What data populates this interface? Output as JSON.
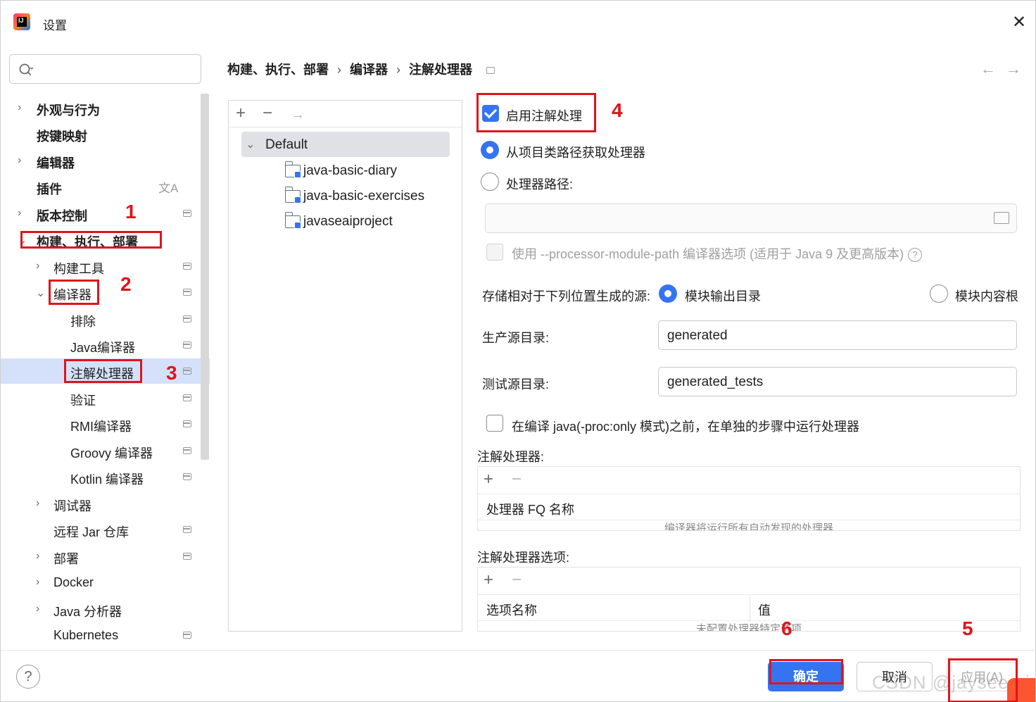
{
  "window": {
    "title": "设置",
    "close_glyph": "✕"
  },
  "search": {
    "placeholder": ""
  },
  "sidebar": {
    "items": [
      {
        "label": "外观与行为",
        "bold": true
      },
      {
        "label": "按键映射",
        "bold": true
      },
      {
        "label": "编辑器",
        "bold": true
      },
      {
        "label": "插件",
        "bold": true
      },
      {
        "label": "版本控制",
        "bold": true
      },
      {
        "label": "构建、执行、部署",
        "bold": true
      },
      {
        "label": "构建工具"
      },
      {
        "label": "编译器"
      },
      {
        "label": "排除"
      },
      {
        "label": "Java编译器"
      },
      {
        "label": "注解处理器",
        "selected": true
      },
      {
        "label": "验证"
      },
      {
        "label": "RMI编译器"
      },
      {
        "label": "Groovy 编译器"
      },
      {
        "label": "Kotlin 编译器"
      },
      {
        "label": "调试器"
      },
      {
        "label": "远程 Jar 仓库"
      },
      {
        "label": "部署"
      },
      {
        "label": "Docker"
      },
      {
        "label": "Java 分析器"
      },
      {
        "label": "Kubernetes"
      }
    ],
    "translate_icon": "文A"
  },
  "annotations": [
    "1",
    "2",
    "3",
    "4",
    "5",
    "6"
  ],
  "breadcrumb": {
    "items": [
      "构建、执行、部署",
      "编译器",
      "注解处理器"
    ],
    "sep": "›"
  },
  "nav": {
    "back": "←",
    "forward": "→"
  },
  "profiles": {
    "toolbar": {
      "add": "+",
      "remove": "−",
      "move": "→"
    },
    "default_label": "Default",
    "modules": [
      "java-basic-diary",
      "java-basic-exercises",
      "javaseaiproject"
    ]
  },
  "form": {
    "enable_label": "启用注解处理",
    "enable_checked": true,
    "obtain_from_classpath": "从项目类路径获取处理器",
    "processor_path": "处理器路径:",
    "processor_path_value": "",
    "use_module_path": "使用 --processor-module-path 编译器选项 (适用于 Java 9 及更高版本)",
    "help": "?",
    "store_label": "存储相对于下列位置生成的源:",
    "store_module_output": "模块输出目录",
    "store_content_root": "模块内容根",
    "prod_label": "生产源目录:",
    "prod_value": "generated",
    "test_label": "测试源目录:",
    "test_value": "generated_tests",
    "run_separately": "在编译 java(-proc:only 模式)之前，在单独的步骤中运行处理器"
  },
  "processors_table": {
    "title": "注解处理器:",
    "add": "+",
    "remove": "−",
    "header": "处理器 FQ 名称",
    "empty": "编译器将运行所有自动发现的处理器"
  },
  "options_table": {
    "title": "注解处理器选项:",
    "add": "+",
    "remove": "−",
    "col_name": "选项名称",
    "col_value": "值",
    "empty": "未配置处理器特定选项"
  },
  "footer": {
    "help": "?",
    "ok": "确定",
    "cancel": "取消",
    "apply": "应用(A)"
  },
  "watermark": "CSDN @jaysee-sjc",
  "colors": {
    "accent": "#3574f0",
    "annotation": "#e0141c",
    "selection": "#d5e1fb"
  }
}
